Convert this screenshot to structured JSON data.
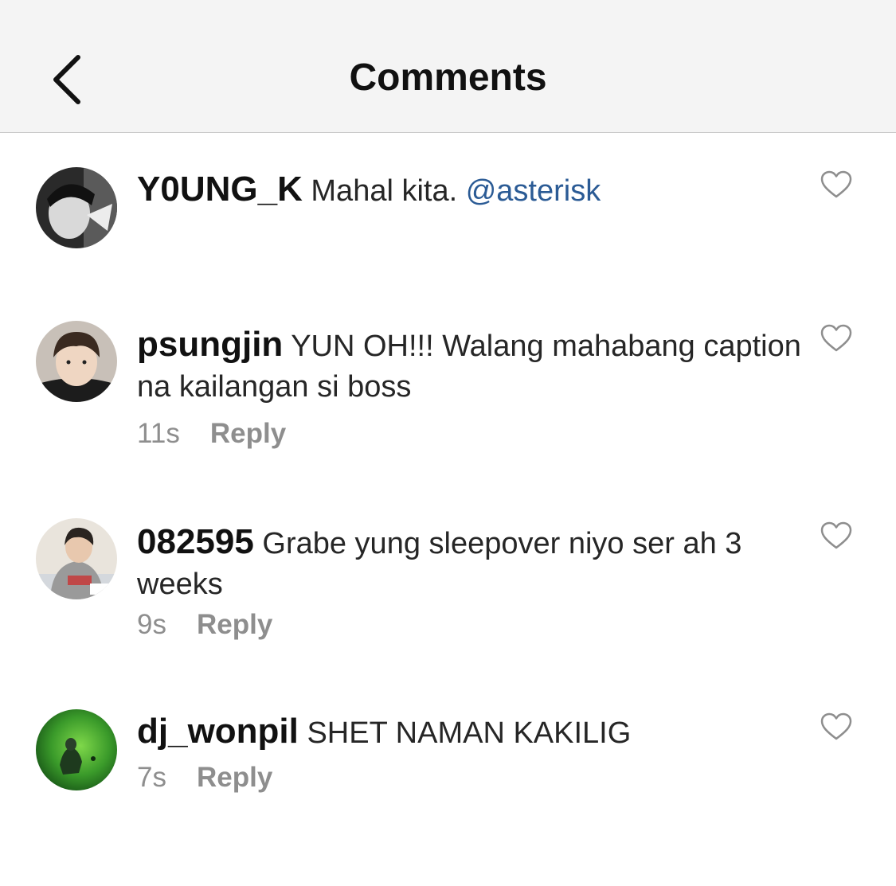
{
  "header": {
    "title": "Comments",
    "back_icon": "chevron-left-icon"
  },
  "colors": {
    "mention": "#2b5b95",
    "meta": "#8e8e8e",
    "nav_background": "#f4f4f4"
  },
  "comments": [
    {
      "username": "Y0UNG_K",
      "text": "Mahal kita. ",
      "mention": "@asterisk",
      "time": "",
      "reply_label": ""
    },
    {
      "username": "psungjin",
      "text": "YUN OH!!! Walang mahabang caption na kailangan si boss",
      "time": "11s",
      "reply_label": "Reply"
    },
    {
      "username": "082595",
      "text": "Grabe yung sleepover niyo ser ah 3 weeks",
      "time": "9s",
      "reply_label": "Reply"
    },
    {
      "username": "dj_wonpil",
      "text": "SHET NAMAN KAKILIG",
      "time": "7s",
      "reply_label": "Reply"
    }
  ]
}
